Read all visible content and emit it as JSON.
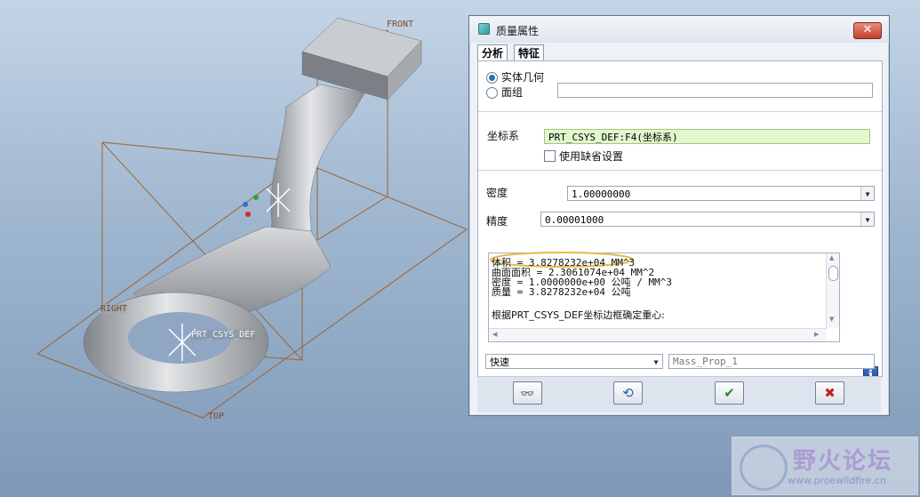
{
  "viewport": {
    "planes": {
      "front": "FRONT",
      "right": "RIGHT",
      "top": "TOP"
    },
    "csys": "PRT_CSYS_DEF"
  },
  "dialog": {
    "title": "质量属性",
    "close_label": "✕",
    "tabs": [
      "分析",
      "特征"
    ],
    "geometry": {
      "solid_label": "实体几何",
      "quilt_label": "面组",
      "quilt_value": "",
      "selected": "solid"
    },
    "csys": {
      "label": "坐标系",
      "value": "PRT_CSYS_DEF:F4(坐标系)",
      "default_label": "使用缺省设置",
      "default_checked": false
    },
    "density": {
      "label": "密度",
      "value": "1.00000000"
    },
    "precision": {
      "label": "精度",
      "value": "0.00001000"
    },
    "results": [
      "体积 =  3.8278232e+04  MM^3",
      "曲面面积 =  2.3061074e+04  MM^2",
      "密度 =  1.0000000e+00 公吨 / MM^3",
      "质量 =  3.8278232e+04 公吨",
      "",
      "根据PRT_CSYS_DEF坐标边框确定重心:"
    ],
    "mode": {
      "value": "快速"
    },
    "feature_name": {
      "placeholder": "Mass_Prop_1"
    },
    "info_label": "i"
  },
  "watermark": {
    "title": "野火论坛",
    "url": "www.proewildfire.cn"
  },
  "colors": {
    "accent": "#2e6fb7",
    "field_green": "#e3f7cc",
    "ok": "#1e8a2c",
    "cancel": "#c0261b",
    "highlight": "#e6b84a"
  }
}
